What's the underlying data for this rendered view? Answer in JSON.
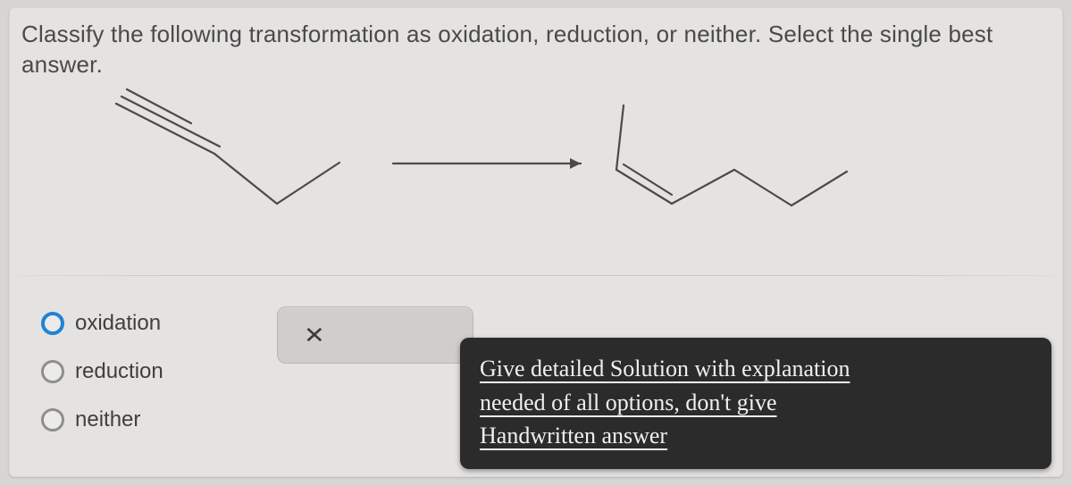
{
  "question": "Classify the following transformation as oxidation, reduction, or neither. Select the single best answer.",
  "options": {
    "a": "oxidation",
    "b": "reduction",
    "c": "neither"
  },
  "note": {
    "line1": "Give detailed Solution with explanation",
    "line2": "needed of all options, don't give",
    "line3": "Handwritten answer"
  },
  "closeGlyph": "✕"
}
